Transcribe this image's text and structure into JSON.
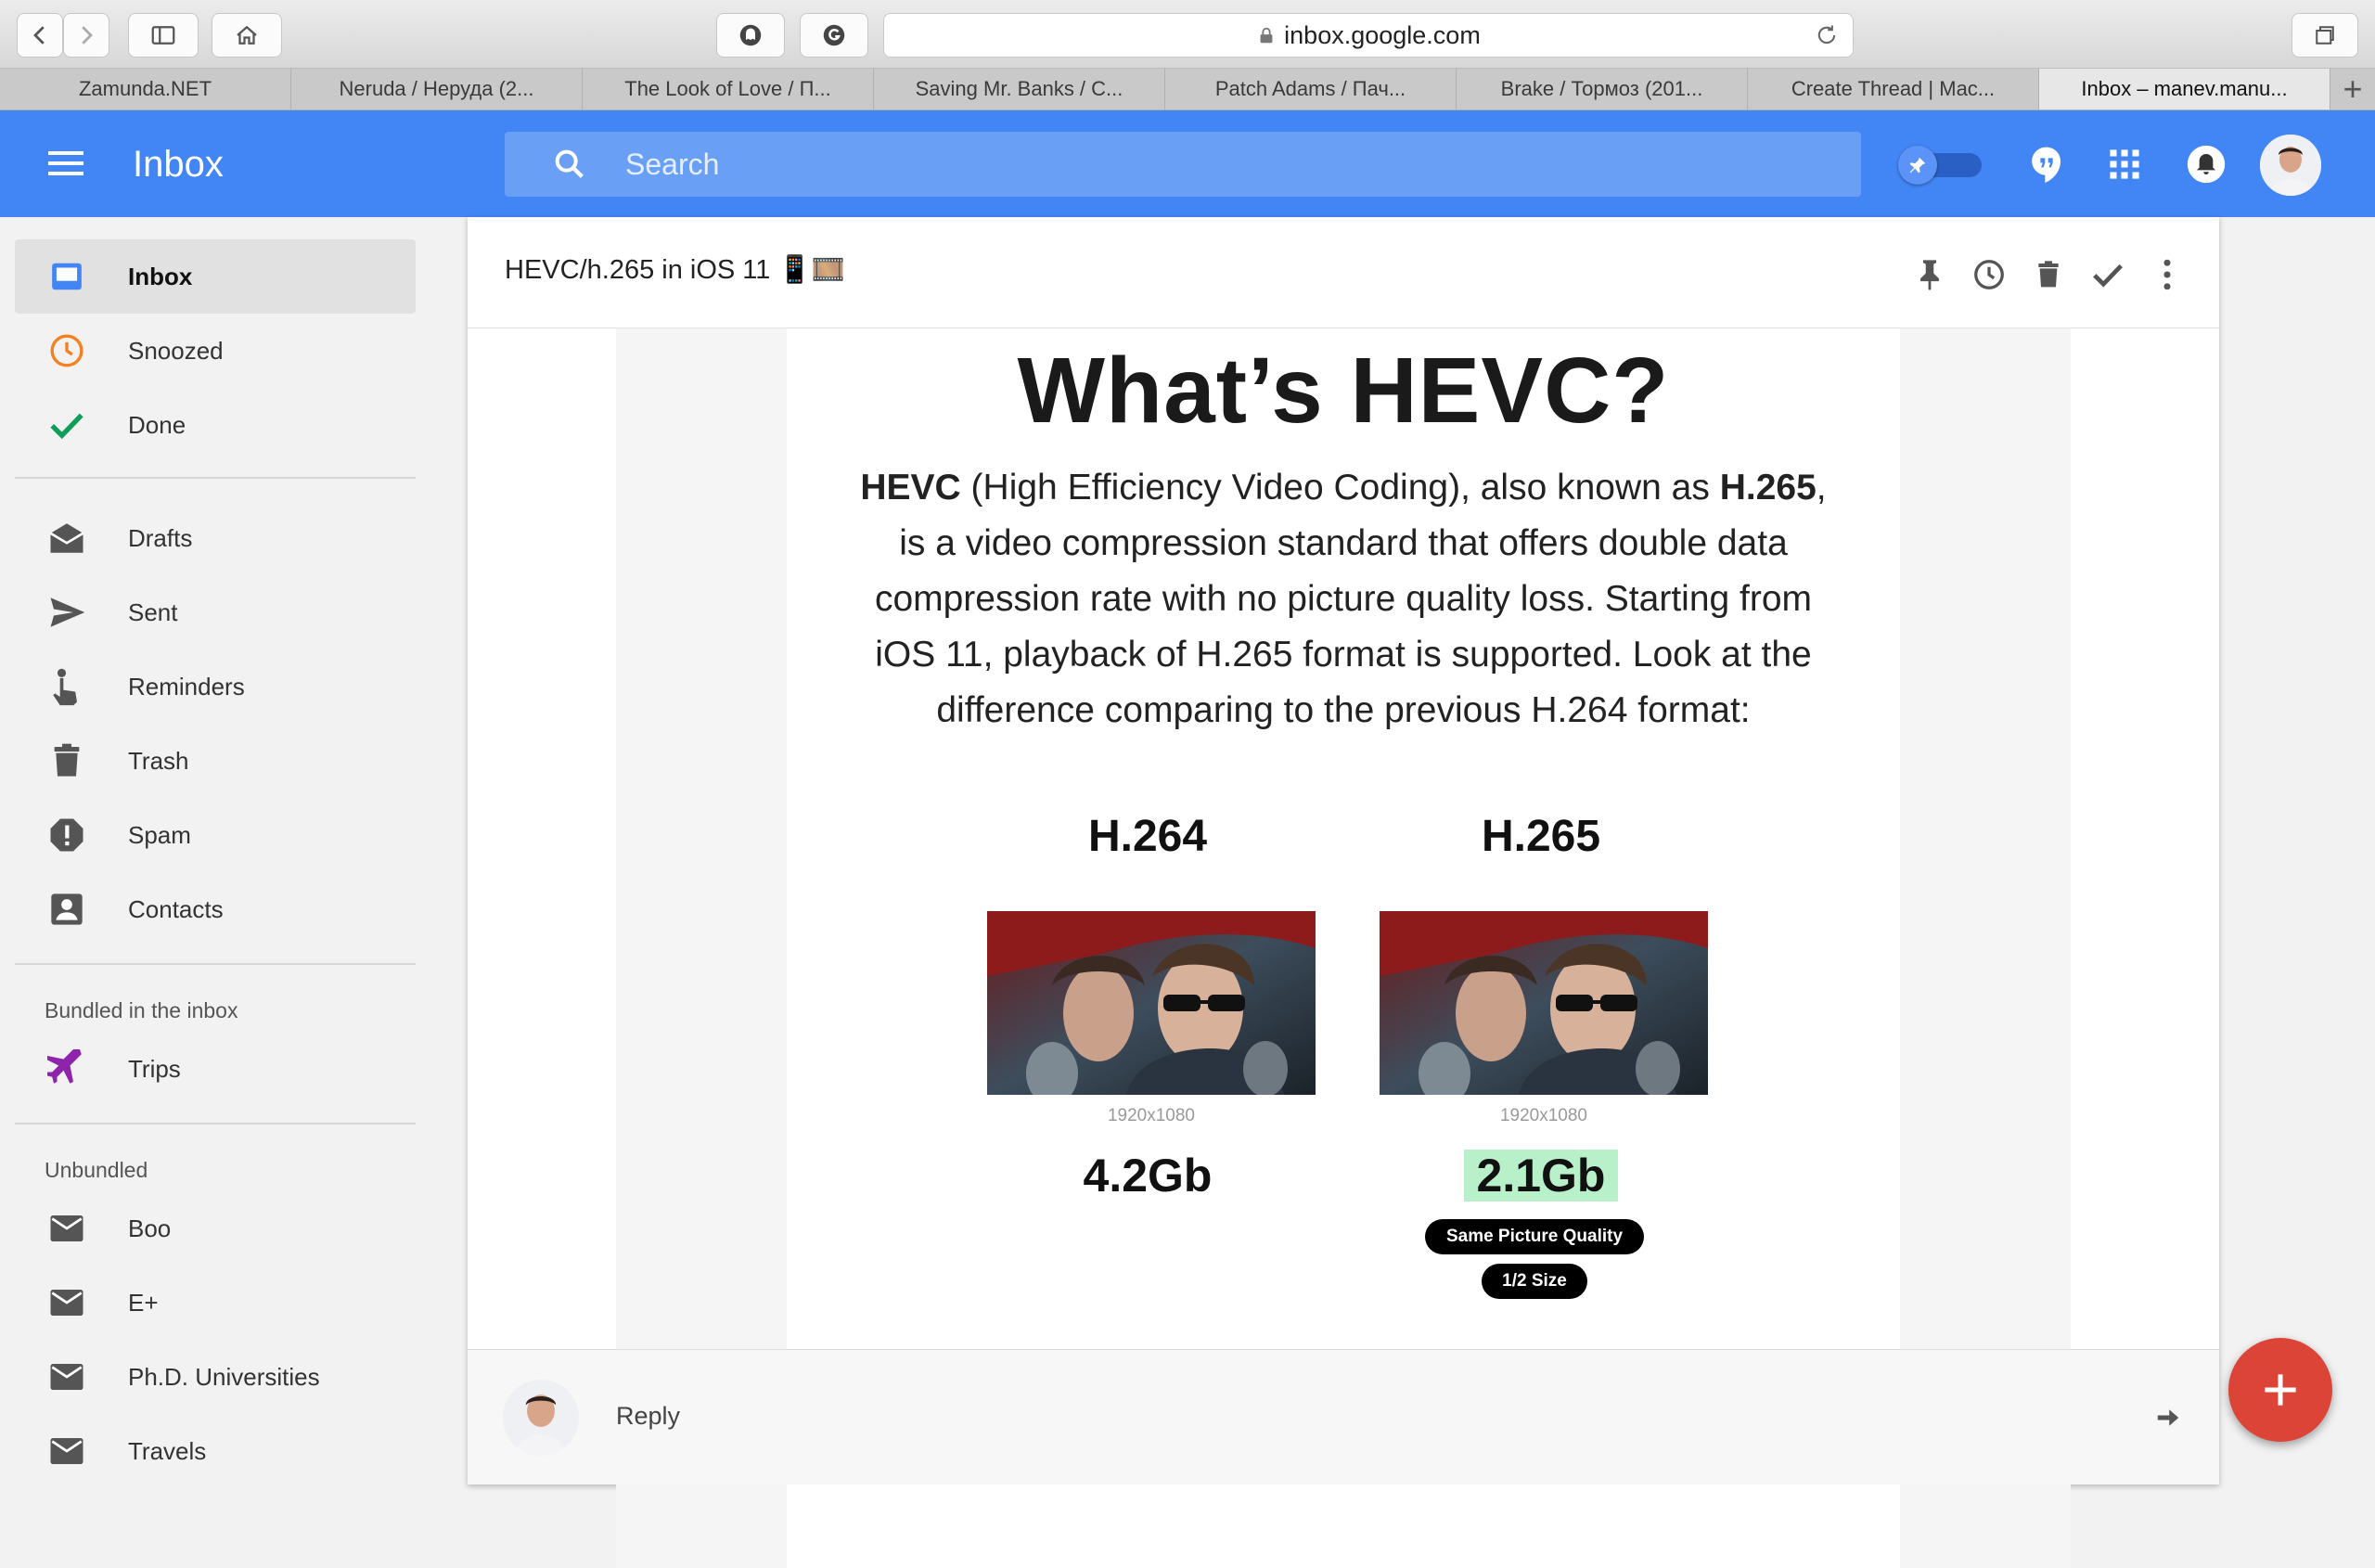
{
  "browser": {
    "url": "inbox.google.com",
    "tabs": [
      {
        "label": "Zamunda.NET"
      },
      {
        "label": "Neruda / Неруда (2..."
      },
      {
        "label": "The Look of Love / П..."
      },
      {
        "label": "Saving Mr. Banks / C..."
      },
      {
        "label": "Patch Adams / Пач..."
      },
      {
        "label": "Brake / Тормоз (201..."
      },
      {
        "label": "Create Thread | Mac..."
      },
      {
        "label": "Inbox – manev.manu..."
      }
    ],
    "new_tab": "+"
  },
  "appbar": {
    "title": "Inbox",
    "search_placeholder": "Search"
  },
  "sidebar": {
    "items": [
      {
        "label": "Inbox"
      },
      {
        "label": "Snoozed"
      },
      {
        "label": "Done"
      },
      {
        "label": "Drafts"
      },
      {
        "label": "Sent"
      },
      {
        "label": "Reminders"
      },
      {
        "label": "Trash"
      },
      {
        "label": "Spam"
      },
      {
        "label": "Contacts"
      }
    ],
    "bundled_header": "Bundled in the inbox",
    "bundled": [
      {
        "label": "Trips"
      }
    ],
    "unbundled_header": "Unbundled",
    "unbundled": [
      {
        "label": "Boo"
      },
      {
        "label": "E+"
      },
      {
        "label": "Ph.D. Universities"
      },
      {
        "label": "Travels"
      }
    ]
  },
  "thread": {
    "subject": "HEVC/h.265 in iOS 11",
    "subject_emoji": "📱🎞️",
    "message": {
      "title": "What’s HEVC?",
      "p_hevc": "HEVC",
      "p_1": " (High Efficiency Video Coding), also known as ",
      "p_h265": "H.265",
      "p_2": ", is a video compression standard that offers double data compression rate with no picture quality loss. Starting from iOS 11, playback of H.265 format is supported. Look at the difference comparing to the previous H.264 format:",
      "left": {
        "codec": "H.264",
        "resolution": "1920x1080",
        "size": "4.2Gb"
      },
      "right": {
        "codec": "H.265",
        "resolution": "1920x1080",
        "size": "2.1Gb",
        "badge1": "Same Picture Quality",
        "badge2": "1/2 Size"
      }
    },
    "reply_label": "Reply"
  },
  "colors": {
    "appbar": "#4285f4",
    "fab": "#db4437",
    "highlight": "#b8f0c9"
  }
}
